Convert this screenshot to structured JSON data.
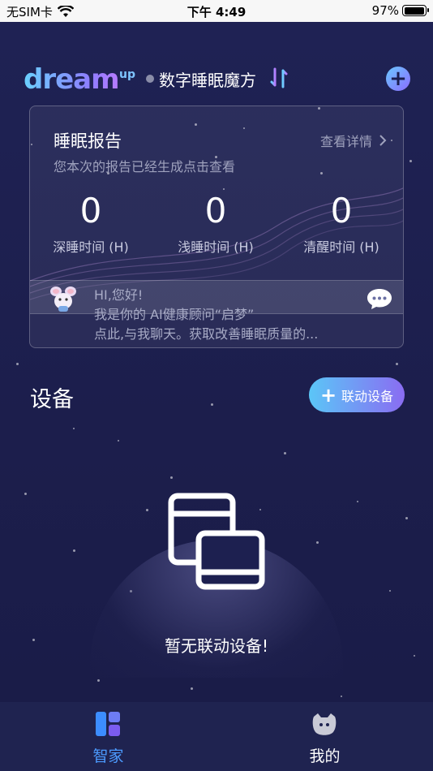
{
  "status_bar": {
    "carrier": "无SIM卡",
    "time": "下午 4:49",
    "battery": "97%",
    "battery_level": 0.97
  },
  "header": {
    "logo": "dream",
    "logo_sup": "up",
    "device_name": "数字睡眠魔方"
  },
  "report": {
    "title": "睡眠报告",
    "detail_link": "查看详情",
    "subtitle": "您本次的报告已经生成点击查看",
    "stats": [
      {
        "value": "0",
        "label": "深睡时间 (H)"
      },
      {
        "value": "0",
        "label": "浅睡时间 (H)"
      },
      {
        "value": "0",
        "label": "清醒时间 (H)"
      }
    ],
    "ai": {
      "line1": "HI,您好!",
      "line2": "我是你的 AI健康顾问“启梦”",
      "line3": "点此,与我聊天。获取改善睡眠质量的..."
    }
  },
  "devices": {
    "title": "设备",
    "link_button": "联动设备",
    "empty_text": "暂无联动设备!"
  },
  "tabs": [
    {
      "label": "智家",
      "active": true
    },
    {
      "label": "我的",
      "active": false
    }
  ],
  "colors": {
    "accent_blue": "#4c9bff",
    "gradient_start": "#5bc6f7",
    "gradient_end": "#8a6cf2",
    "background": "#1b1e4f"
  }
}
